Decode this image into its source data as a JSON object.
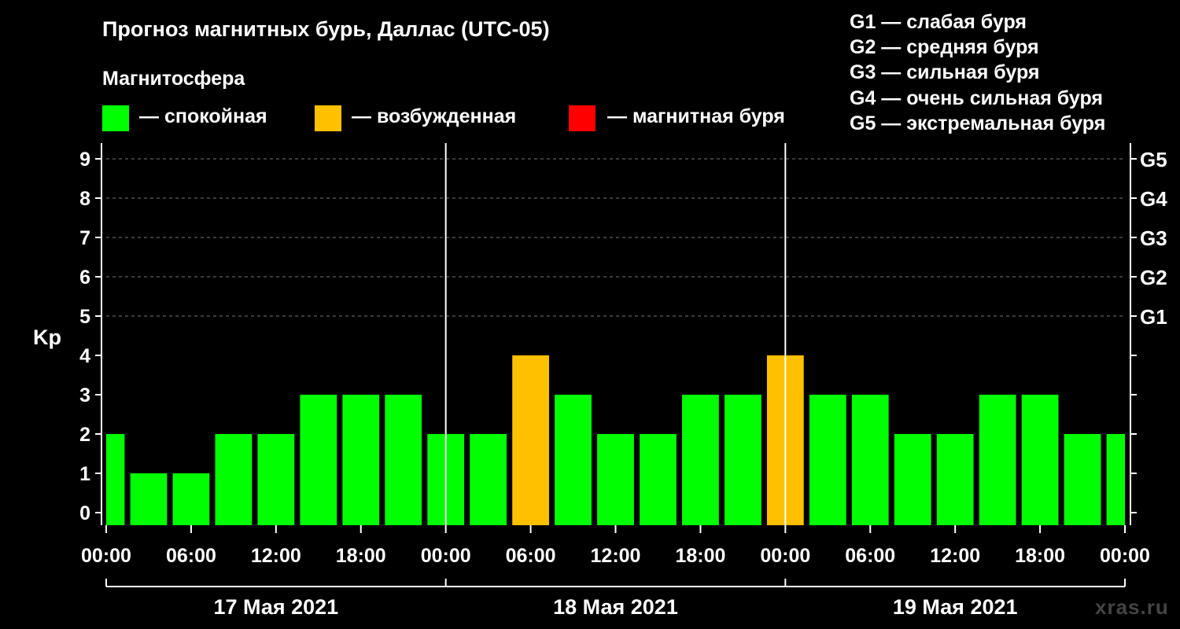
{
  "header": {
    "title": "Прогноз магнитных бурь, Даллас (UTC-05)",
    "magnetosphere_title": "Магнитосфера"
  },
  "legend": {
    "items": [
      {
        "label": "— спокойная",
        "color": "#00ff00"
      },
      {
        "label": "— возбужденная",
        "color": "#ffc000"
      },
      {
        "label": "— магнитная буря",
        "color": "#ff0000"
      }
    ]
  },
  "storm_levels": [
    "G1 — слабая буря",
    "G2 — средняя буря",
    "G3 — сильная буря",
    "G4 — очень сильная буря",
    "G5 — экстремальная буря"
  ],
  "watermark": "xras.ru",
  "chart_data": {
    "type": "bar",
    "ylabel": "Kp",
    "ylim": [
      0,
      9
    ],
    "yticks": [
      "0",
      "1",
      "2",
      "3",
      "4",
      "5",
      "6",
      "7",
      "8",
      "9"
    ],
    "right_axis_labels": [
      {
        "kp": 5,
        "label": "G1"
      },
      {
        "kp": 6,
        "label": "G2"
      },
      {
        "kp": 7,
        "label": "G3"
      },
      {
        "kp": 8,
        "label": "G4"
      },
      {
        "kp": 9,
        "label": "G5"
      }
    ],
    "grid": "horizontal dashed at Kp 5–9",
    "x_tick_labels": [
      "00:00",
      "06:00",
      "12:00",
      "18:00",
      "00:00",
      "06:00",
      "12:00",
      "18:00",
      "00:00",
      "06:00",
      "12:00",
      "18:00",
      "00:00"
    ],
    "dates": [
      "17 Мая 2021",
      "18 Мая 2021",
      "19 Мая 2021"
    ],
    "interval_hours": 3,
    "kp_values": [
      2,
      1,
      1,
      2,
      2,
      3,
      3,
      3,
      2,
      2,
      4,
      3,
      2,
      2,
      3,
      3,
      4,
      3,
      3,
      2,
      2,
      3,
      3,
      2,
      2
    ],
    "status_colors": {
      "quiet": "#00ff00",
      "active": "#ffc000",
      "storm": "#ff0000"
    }
  }
}
